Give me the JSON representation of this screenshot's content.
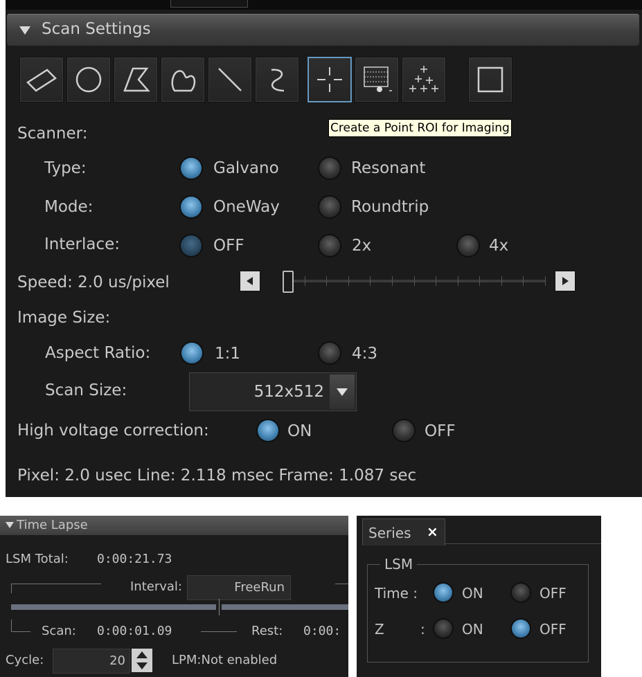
{
  "scan_settings": {
    "title": "Scan Settings",
    "tooltip": "Create a Point ROI for Imaging",
    "tools": [
      "rectangle-roi-icon",
      "circle-roi-icon",
      "polygon-roi-icon",
      "freehand-roi-icon",
      "line-roi-icon",
      "polyline-roi-icon",
      "point-roi-icon",
      "grid-roi-icon",
      "multipoint-roi-icon",
      "clear-roi-icon"
    ],
    "scanner_label": "Scanner:",
    "type_label": "Type:",
    "type_options": [
      "Galvano",
      "Resonant"
    ],
    "mode_label": "Mode:",
    "mode_options": [
      "OneWay",
      "Roundtrip"
    ],
    "interlace_label": "Interlace:",
    "interlace_options": [
      "OFF",
      "2x",
      "4x"
    ],
    "speed_label": "Speed:  2.0 us/pixel",
    "speed_slider_fraction": 0.0,
    "image_size_label": "Image Size:",
    "aspect_label": "Aspect Ratio:",
    "aspect_options": [
      "1:1",
      "4:3"
    ],
    "scan_size_label": "Scan Size:",
    "scan_size_value": "512x512",
    "hv_label": "High voltage correction:",
    "hv_options": [
      "ON",
      "OFF"
    ],
    "summary": "Pixel: 2.0 usec Line: 2.118 msec Frame: 1.087 sec"
  },
  "time_lapse": {
    "title": "Time Lapse",
    "lsm_total_label": "LSM Total:",
    "lsm_total_value": "0:00:21.73",
    "interval_label": "Interval:",
    "interval_value": "FreeRun",
    "scan_label": "Scan:",
    "scan_value": "0:00:01.09",
    "rest_label": "Rest:",
    "rest_value": "0:00:",
    "cycle_label": "Cycle:",
    "cycle_value": "20",
    "lpm_status": "LPM:Not enabled"
  },
  "series": {
    "tab_label": "Series",
    "close_glyph": "×",
    "group_label": "LSM",
    "time_label": "Time :",
    "z_label": "Z",
    "z_colon": ":",
    "on_label": "ON",
    "off_label": "OFF"
  }
}
